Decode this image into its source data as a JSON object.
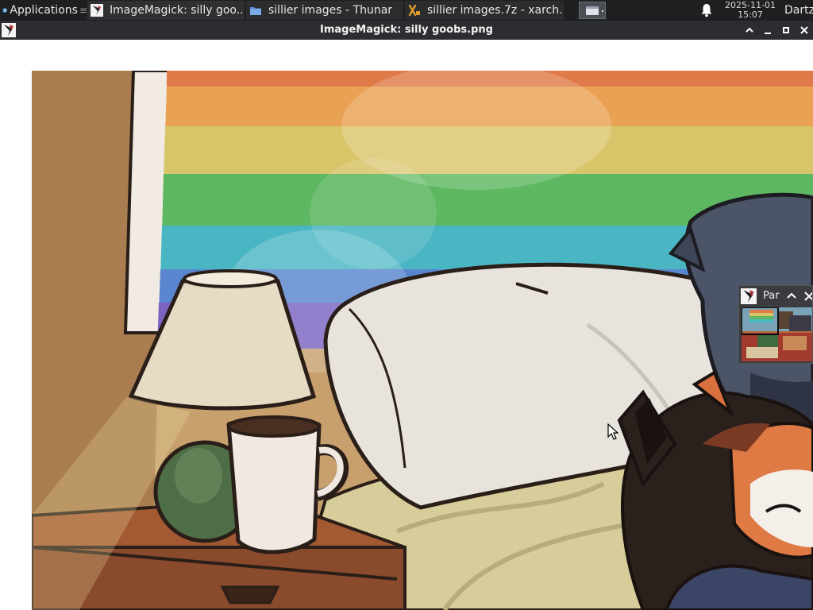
{
  "panel": {
    "applications_label": "Applications",
    "tasks": [
      {
        "label": "ImageMagick: silly goo...",
        "icon": "imagemagick-icon"
      },
      {
        "label": "sillier images - Thunar",
        "icon": "folder-icon"
      },
      {
        "label": "sillier images.7z - xarch...",
        "icon": "archive-icon"
      }
    ],
    "clock_date": "2025-11-01",
    "clock_time": "15:07",
    "user": "Dartz"
  },
  "window": {
    "title": "ImageMagick: silly goobs.png"
  },
  "pan_window": {
    "title": "Par"
  },
  "colors": {
    "panel_bg": "#1d1f21",
    "titlebar_bg": "#2b2d30",
    "content_bg": "#ffffff"
  }
}
